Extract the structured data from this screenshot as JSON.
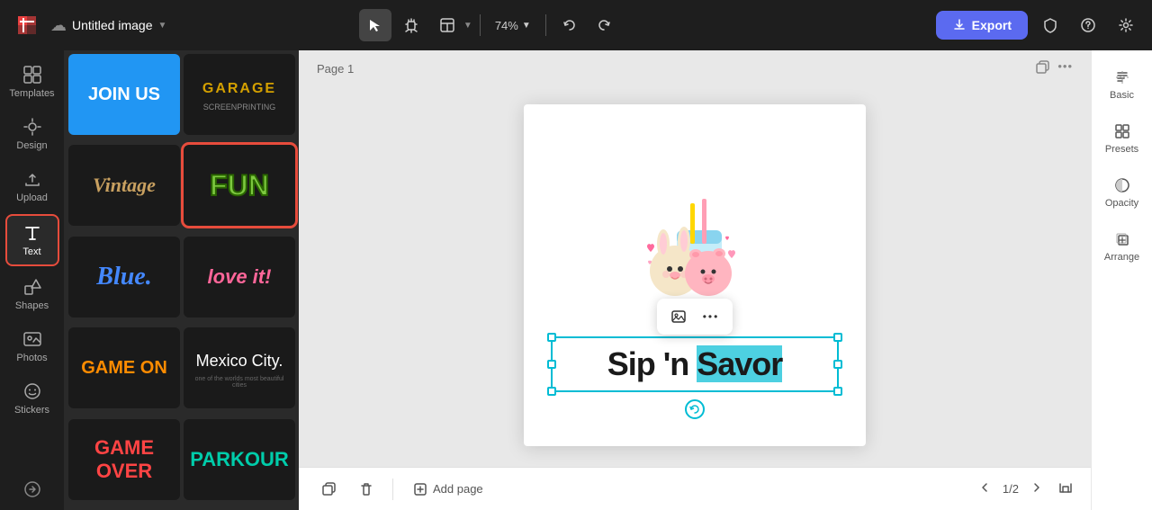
{
  "topbar": {
    "title": "Untitled image",
    "zoom": "74%",
    "export_label": "Export"
  },
  "sidebar": {
    "items": [
      {
        "id": "templates",
        "label": "Templates"
      },
      {
        "id": "design",
        "label": "Design"
      },
      {
        "id": "upload",
        "label": "Upload"
      },
      {
        "id": "text",
        "label": "Text"
      },
      {
        "id": "shapes",
        "label": "Shapes"
      },
      {
        "id": "photos",
        "label": "Photos"
      },
      {
        "id": "stickers",
        "label": "Stickers"
      }
    ]
  },
  "canvas": {
    "page_label": "Page 1",
    "text_content": "Sip 'n Savor"
  },
  "bottom": {
    "add_page_label": "Add page",
    "pagination": "1/2"
  },
  "right_panel": {
    "items": [
      {
        "id": "basic",
        "label": "Basic"
      },
      {
        "id": "presets",
        "label": "Presets"
      },
      {
        "id": "opacity",
        "label": "Opacity"
      },
      {
        "id": "arrange",
        "label": "Arrange"
      }
    ]
  },
  "template_cards": [
    {
      "id": "join-us",
      "bg": "#2196f3",
      "text": "JOIN US",
      "text_color": "#fff",
      "font_weight": "900"
    },
    {
      "id": "garage",
      "bg": "#1a1a1a",
      "text": "GARAGE",
      "text_color": "#d4a000",
      "font_weight": "900"
    },
    {
      "id": "vintage",
      "bg": "#1a1a1a",
      "text": "Vintage",
      "text_color": "#c8a060",
      "font_weight": "700"
    },
    {
      "id": "fun",
      "bg": "#1a1a1a",
      "text": "FUN",
      "text_color": "#7dc940",
      "font_weight": "900",
      "selected": true
    },
    {
      "id": "blue",
      "bg": "#1a1a1a",
      "text": "Blue.",
      "text_color": "#4488ff",
      "font_weight": "700"
    },
    {
      "id": "love-it",
      "bg": "#1a1a1a",
      "text": "love it!",
      "text_color": "#ff6699",
      "font_weight": "700"
    },
    {
      "id": "game-on",
      "bg": "#1a1a1a",
      "text": "GAME ON",
      "text_color": "#ff8c00",
      "font_weight": "900"
    },
    {
      "id": "mexico-city",
      "bg": "#1a1a1a",
      "text": "Mexico City.",
      "text_color": "#fff",
      "font_weight": "300"
    },
    {
      "id": "game-over",
      "bg": "#1a1a1a",
      "text": "GAME OVER",
      "text_color": "#ff4444",
      "font_weight": "900"
    },
    {
      "id": "parkour",
      "bg": "#1a1a1a",
      "text": "PARKOUR",
      "text_color": "#00ccaa",
      "font_weight": "900"
    }
  ]
}
